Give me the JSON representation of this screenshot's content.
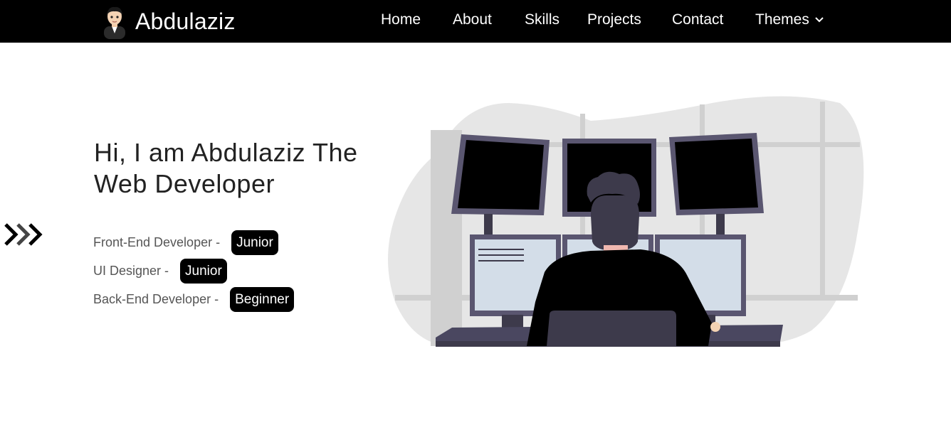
{
  "navbar": {
    "brand_name": "Abdulaziz",
    "links": [
      "Home",
      "About",
      "Skills",
      "Projects",
      "Contact"
    ],
    "themes_label": "Themes"
  },
  "hero": {
    "title": "Hi, I am Abdulaziz The Web Developer",
    "skills": [
      {
        "label": "Front-End Developer -",
        "level": "Junior"
      },
      {
        "label": "UI Designer -",
        "level": "Junior"
      },
      {
        "label": "Back-End Developer -",
        "level": "Beginner"
      }
    ]
  },
  "icons": {
    "avatar": "cartoon-avatar-icon",
    "themes_dropdown": "chevron-down-icon",
    "side_arrows": "triple-chevron-right-icon",
    "illustration": "developer-at-monitors-illustration"
  },
  "colors": {
    "navbar_bg": "#000000",
    "badge_bg": "#000000",
    "badge_text": "#ffffff",
    "page_bg": "#ffffff",
    "illustration_blob": "#e6e6e6",
    "monitor_frame": "#5a5670",
    "screen_light": "#d3dde8"
  }
}
